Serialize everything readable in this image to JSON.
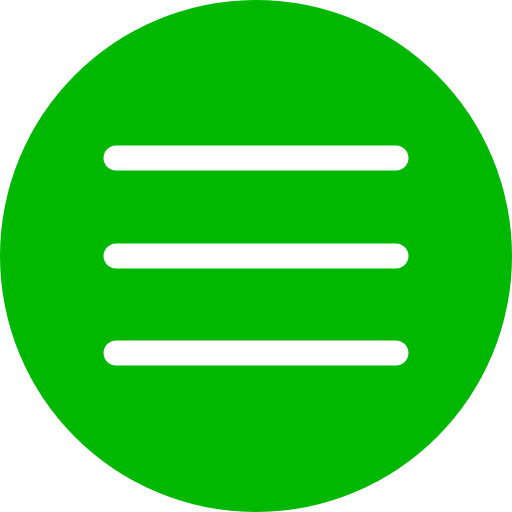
{
  "menu_button": {
    "icon": "hamburger-menu-icon",
    "bars": 3,
    "colors": {
      "background": "#00b800",
      "bar": "#ffffff"
    }
  }
}
